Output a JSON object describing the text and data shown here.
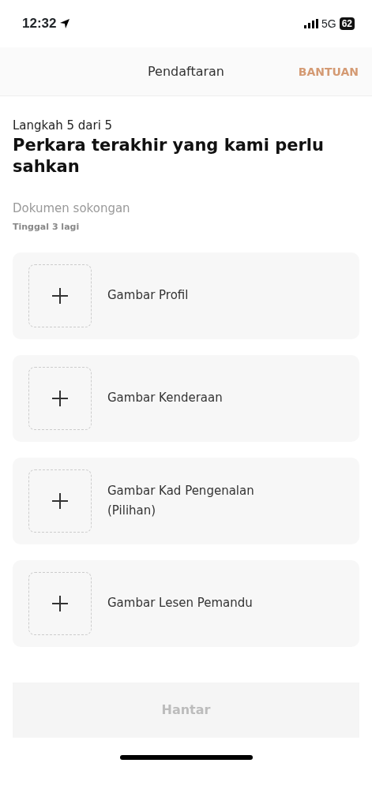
{
  "status_bar": {
    "time": "12:32",
    "network": "5G",
    "battery": "62"
  },
  "header": {
    "title": "Pendaftaran",
    "action": "BANTUAN"
  },
  "step": "Langkah 5 dari 5",
  "heading": "Perkara terakhir yang kami perlu sahkan",
  "section": {
    "title": "Dokumen sokongan",
    "remaining": "Tinggal 3 lagi"
  },
  "uploads": [
    {
      "label": "Gambar Profil"
    },
    {
      "label": "Gambar Kenderaan"
    },
    {
      "label": "Gambar Kad Pengenalan (Pilihan)"
    },
    {
      "label": "Gambar Lesen Pemandu"
    }
  ],
  "submit": {
    "label": "Hantar",
    "disabled": true
  }
}
